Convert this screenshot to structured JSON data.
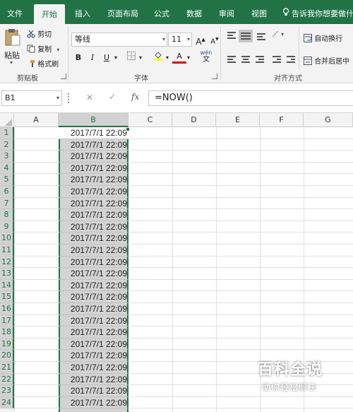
{
  "tabs": [
    "文件",
    "开始",
    "插入",
    "页面布局",
    "公式",
    "数据",
    "审阅",
    "视图"
  ],
  "active_tab": "开始",
  "tell_me": "告诉我你想要做什",
  "clipboard": {
    "paste": "粘贴",
    "cut": "剪切",
    "copy": "复制",
    "format_painter": "格式刷",
    "group_label": "剪贴板"
  },
  "font": {
    "name": "等线",
    "size": "11",
    "bold": "B",
    "italic": "I",
    "underline": "U",
    "grow": "A",
    "shrink": "A",
    "wen": "wén",
    "font_color": "A",
    "group_label": "字体"
  },
  "alignment": {
    "wrap_text": "自动换行",
    "merge_center": "合并后居中",
    "group_label": "对齐方式"
  },
  "formula_bar": {
    "name_box": "B1",
    "formula": "=NOW()",
    "cancel": "✕",
    "enter": "✓",
    "fx": "fx"
  },
  "columns": [
    "A",
    "B",
    "C",
    "D",
    "E",
    "F",
    "G"
  ],
  "selected_column": "B",
  "rows": [
    "1",
    "2",
    "3",
    "4",
    "5",
    "6",
    "7",
    "8",
    "9",
    "10",
    "11",
    "12",
    "13",
    "14",
    "15",
    "16",
    "17",
    "18",
    "19",
    "20",
    "21",
    "22",
    "23",
    "24"
  ],
  "b_values": [
    "2017/7/1 22:09",
    "2017/7/1 22:09",
    "2017/7/1 22:09",
    "2017/7/1 22:09",
    "2017/7/1 22:09",
    "2017/7/1 22:09",
    "2017/7/1 22:09",
    "2017/7/1 22:09",
    "2017/7/1 22:09",
    "2017/7/1 22:09",
    "2017/7/1 22:09",
    "2017/7/1 22:09",
    "2017/7/1 22:09",
    "2017/7/1 22:09",
    "2017/7/1 22:09",
    "2017/7/1 22:09",
    "2017/7/1 22:09",
    "2017/7/1 22:09",
    "2017/7/1 22:09",
    "2017/7/1 22:09",
    "2017/7/1 22:09",
    "2017/7/1 22:09",
    "2017/7/1 22:09",
    "2017/7/1 22:09"
  ],
  "watermark": {
    "title": "百科全说",
    "subtitle": "助你轻松解决"
  },
  "colors": {
    "accent": "#217346",
    "selection": "#d3d3d3"
  }
}
